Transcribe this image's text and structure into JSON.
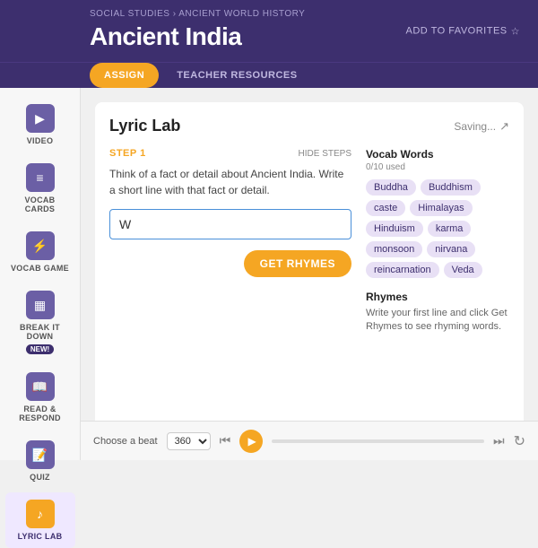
{
  "header": {
    "breadcrumb": "Social Studies › Ancient World History",
    "title": "Ancient India",
    "add_favorites": "Add to Favorites"
  },
  "tabs": {
    "assign": "Assign",
    "teacher_resources": "Teacher Resources"
  },
  "sidebar": {
    "items": [
      {
        "label": "Video",
        "icon": "▶"
      },
      {
        "label": "Vocab Cards",
        "icon": "📋"
      },
      {
        "label": "Vocab Game",
        "icon": "⚡"
      },
      {
        "label": "Break It Down",
        "icon": "📊",
        "badge": "NEW!"
      },
      {
        "label": "Read & Respond",
        "icon": "📖"
      },
      {
        "label": "Quiz",
        "icon": "📝"
      },
      {
        "label": "Lyric Lab",
        "icon": "🎵",
        "active": true
      }
    ]
  },
  "lyric_lab": {
    "title": "Lyric Lab",
    "saving": "Saving...",
    "step_label": "Step 1",
    "hide_steps": "Hide Steps",
    "step_description": "Think of a fact or detail about Ancient India. Write a short line with that fact or detail.",
    "input_value": "W",
    "get_rhymes_label": "Get Rhymes",
    "vocab_title": "Vocab Words",
    "vocab_count": "0/10 used",
    "vocab_tags": [
      "Buddha",
      "Buddhism",
      "caste",
      "Himalayas",
      "Hinduism",
      "karma",
      "monsoon",
      "nirvana",
      "reincarnation",
      "Veda"
    ],
    "rhymes_title": "Rhymes",
    "rhymes_description": "Write your first line and click Get Rhymes to see rhyming words."
  },
  "beat_player": {
    "label": "Choose a beat",
    "bpm": "360",
    "progress": 0
  }
}
